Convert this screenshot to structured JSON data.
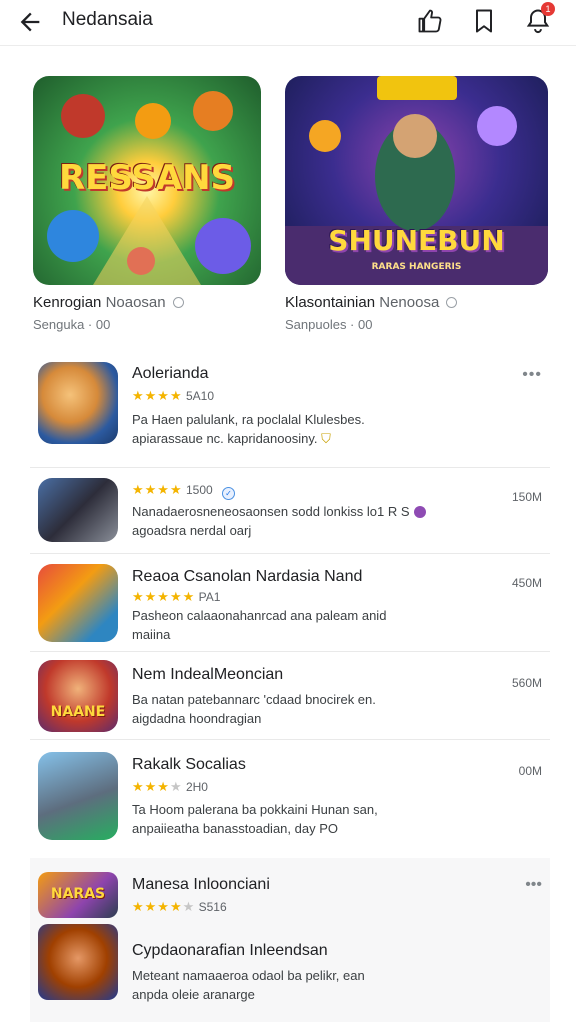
{
  "topbar": {
    "title": "Nedansaia",
    "icons": [
      "back-arrow-icon",
      "thumbs-up-icon",
      "bookmark-icon",
      "notification-bell-icon"
    ],
    "notification_count": "1"
  },
  "featured": [
    {
      "art_title": "RESSANS",
      "title": "Kenrogian",
      "publisher": "Noaosan",
      "subtitle": "Senguka · 00"
    },
    {
      "art_title": "SHUNEBUN",
      "art_tagline": "RARAS HANGERIS",
      "title": "Klasontainian",
      "publisher": "Nenoosa",
      "subtitle": "Sanpuoles · 00"
    }
  ],
  "list": [
    {
      "name": "Aolerianda",
      "rating_value": "5A10",
      "stars": 4,
      "desc_line1": "Pa Haen palulank, ra poclalal Klulesbes.",
      "desc_line2": "apiarassaue nc. kapridanoosiny.",
      "more": "•••"
    },
    {
      "name": "",
      "rating_value": "1500",
      "stars": 4,
      "desc_line1": "Nanadaerosneneosaonsen sodd lonkiss lo1 R S",
      "desc_line2": "agoadsra nerdal oarj",
      "size": "150M"
    },
    {
      "name": "Reaoa Csanolan Nardasia Nand",
      "rating_value": "PA1",
      "stars": 5,
      "desc_line1": "Pasheon calaaonahanrcad ana paleam anid",
      "desc_line2": "maiina",
      "size": "450M"
    },
    {
      "name": "Nem IndealMeoncian",
      "art_title": "NAANE",
      "desc_line1": "Ba natan patebannarc 'cdaad bnocirek en.",
      "desc_line2": "aigdadna hoondragian",
      "size": "560M"
    },
    {
      "name": "Rakalk Socalias",
      "rating_value": "2H0",
      "stars": 3,
      "desc_line1": "Ta Hoom palerana ba pokkaini Hunan san,",
      "desc_line2": "anpaiieatha banasstoadian, day PO",
      "size": "00M"
    },
    {
      "name": "Manesa Inloonciani",
      "art_title": "NARAS",
      "rating_value": "S516",
      "stars": 4,
      "more": "•••"
    },
    {
      "name": "Cypdaonarafian Inleendsan",
      "desc_line1": "Meteant namaaeroa odaol ba pelikr, ean",
      "desc_line2": "anpda oleie aranarge"
    }
  ],
  "colors": {
    "star": "#f4b400",
    "badge": "#e53935",
    "divider": "#e9e9e9"
  }
}
